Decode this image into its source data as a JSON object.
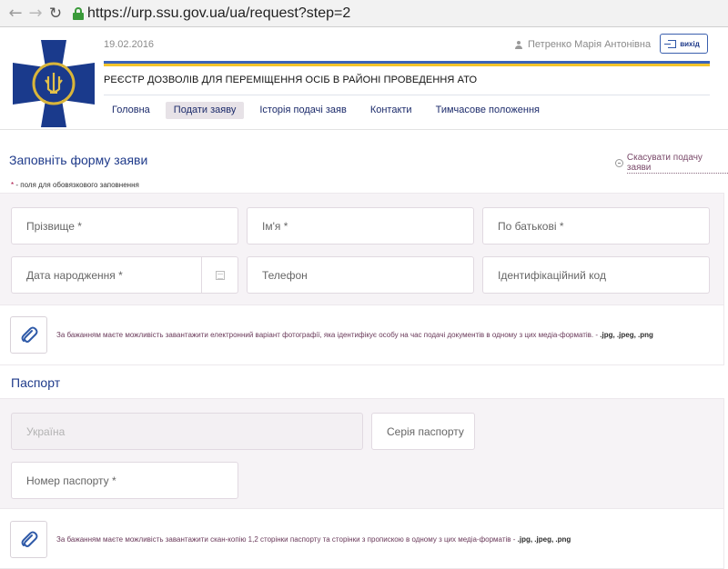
{
  "browser": {
    "url": "https://urp.ssu.gov.ua/ua/request?step=2"
  },
  "header": {
    "date": "19.02.2016",
    "user_name": "Петренко Марія Антонівна",
    "exit_label": "вихід",
    "title": "РЕЄСТР ДОЗВОЛІВ ДЛЯ ПЕРЕМІЩЕННЯ ОСІБ В РАЙОНІ ПРОВЕДЕННЯ АТО"
  },
  "menu": {
    "items": [
      "Головна",
      "Подати заяву",
      "Історія подачі заяв",
      "Контакти",
      "Тимчасове положення"
    ],
    "active": "Подати заяву"
  },
  "form": {
    "title": "Заповніть форму заяви",
    "cancel_label": "Скасувати подачу заяви",
    "required_note_star": "*",
    "required_note": " - поля для обовязкового заповнення",
    "fields": {
      "surname": "Прізвище *",
      "name": "Ім'я *",
      "patronymic": "По батькові *",
      "birthdate": "Дата народження *",
      "phone": "Телефон",
      "tax_id": "Ідентифікаційний код"
    },
    "photo_upload_text": "За бажанням маєте можливість завантажити електронний варіант фотографії, яка ідентифікує особу на час подачі документів в одному з цих медіа-форматів. - ",
    "photo_formats": ".jpg, .jpeg, .png"
  },
  "passport": {
    "title": "Паспорт",
    "country": "Україна",
    "series": "Серія паспорту",
    "number": "Номер паспорту *",
    "upload_text": "За бажанням маєте можливість завантажити скан-копію 1,2 сторінки паспорту та сторінки з пропискою в одному з цих медіа-форматів - ",
    "upload_formats": ".jpg, .jpeg, .png"
  },
  "colors": {
    "accent_blue": "#1e3a8a",
    "flag_blue": "#3a63b8",
    "flag_yellow": "#f3c42b",
    "section_bg": "#f6f3f6"
  }
}
